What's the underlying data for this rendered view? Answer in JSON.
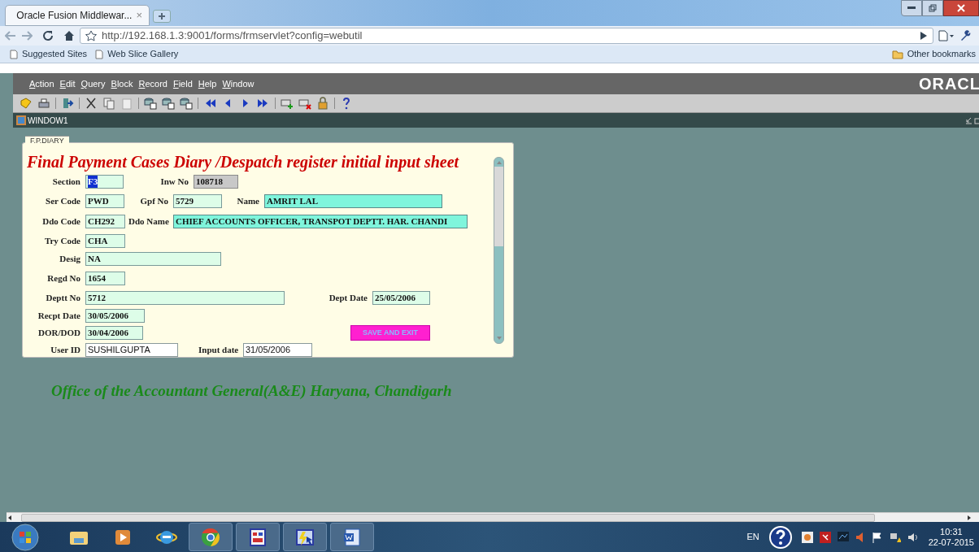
{
  "browser": {
    "tab": {
      "title": "Oracle Fusion Middlewar...",
      "close": "×"
    },
    "address": "http://192.168.1.3:9001/forms/frmservlet?config=webutil",
    "bookmarks": [
      "Suggested Sites",
      "Web Slice Gallery"
    ],
    "other_bookmarks": "Other bookmarks"
  },
  "menu": [
    "Action",
    "Edit",
    "Query",
    "Block",
    "Record",
    "Field",
    "Help",
    "Window"
  ],
  "brand": "ORACL",
  "window": {
    "title": "WINDOW1"
  },
  "form": {
    "tab": "F.P.DIARY",
    "title": "Final Payment Cases Diary /Despatch register initial input sheet",
    "rows": [
      [
        {
          "label": "Section",
          "value": "F3",
          "kind": "selected"
        },
        {
          "label": "Inw No",
          "value": "108718",
          "kind": "grey"
        }
      ],
      [
        {
          "label": "Ser Code",
          "value": "PWD",
          "kind": "pale"
        },
        {
          "label": "Gpf No",
          "value": "5729",
          "kind": "pale"
        },
        {
          "label": "Name",
          "value": "AMRIT LAL",
          "kind": "cyan"
        }
      ],
      [
        {
          "label": "Ddo Code",
          "value": "CH292",
          "kind": "pale"
        },
        {
          "label": "Ddo Name",
          "value": "CHIEF ACCOUNTS OFFICER, TRANSPOT DEPTT. HAR. CHANDI",
          "kind": "cyan"
        }
      ],
      [
        {
          "label": "Try Code",
          "value": "CHA",
          "kind": "pale"
        }
      ],
      [
        {
          "label": "Desig",
          "value": "NA",
          "kind": "pale"
        }
      ],
      [
        {
          "label": "Regd No",
          "value": "1654",
          "kind": "pale"
        }
      ],
      [
        {
          "label": "Deptt No",
          "value": "5712",
          "kind": "pale"
        },
        {
          "label": "Dept Date",
          "value": "25/05/2006",
          "kind": "pale"
        }
      ],
      [
        {
          "label": "Recpt Date",
          "value": "30/05/2006",
          "kind": "pale"
        }
      ],
      [
        {
          "label": "DOR/DOD",
          "value": "30/04/2006",
          "kind": "pale"
        },
        {
          "button": "SAVE AND EXIT"
        }
      ],
      [
        {
          "label": "User ID",
          "value": "SUSHILGUPTA",
          "kind": "plain"
        },
        {
          "label": "Input date",
          "value": "31/05/2006",
          "kind": "plain"
        }
      ]
    ]
  },
  "footer": "Office of the Accountant General(A&E) Haryana, Chandigarh",
  "taskbar": {
    "language": "EN",
    "time": "10:31",
    "date": "22-07-2015"
  }
}
